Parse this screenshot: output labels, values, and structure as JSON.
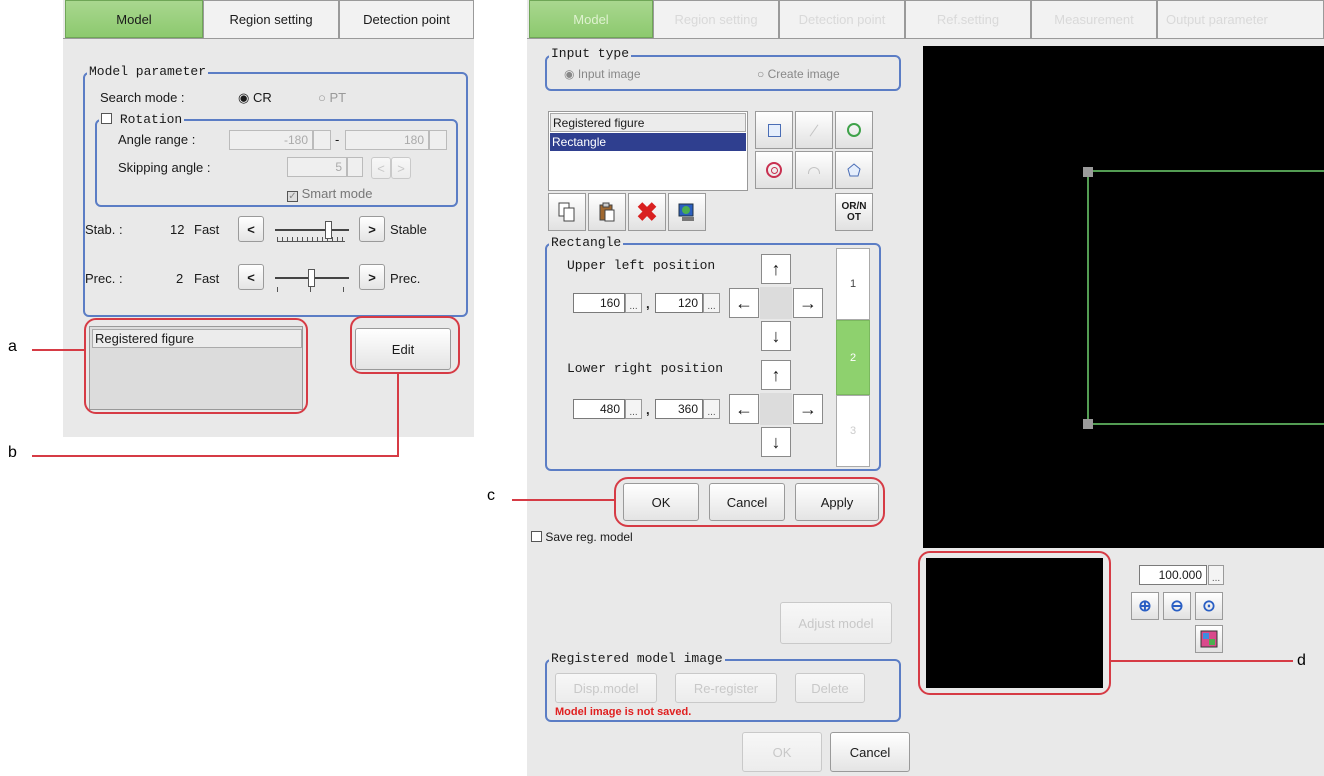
{
  "left_window": {
    "tabs": [
      "Model",
      "Region setting",
      "Detection point"
    ],
    "model_parameter": {
      "title": "Model parameter",
      "search_mode_label": "Search mode :",
      "search_mode_options": [
        "CR",
        "PT"
      ],
      "search_mode_selected": "CR",
      "rotation": {
        "title": "Rotation",
        "checked": false,
        "angle_range_label": "Angle range :",
        "angle_from": "-180",
        "angle_sep": "-",
        "angle_to": "180",
        "skipping_angle_label": "Skipping angle :",
        "skipping_angle": "5",
        "smart_mode_label": "Smart mode",
        "smart_mode_checked": true
      },
      "stab": {
        "label": "Stab. :",
        "value": "12",
        "left": "Fast",
        "right": "Stable",
        "dec": "<",
        "inc": ">",
        "level": 0.75
      },
      "prec": {
        "label": "Prec. :",
        "value": "2",
        "left": "Fast",
        "right": "Prec.",
        "dec": "<",
        "inc": ">",
        "level": 0.5
      }
    },
    "registered_figure_header": "Registered figure",
    "edit_button": "Edit"
  },
  "right_window": {
    "tabs": [
      "Model",
      "Region setting",
      "Detection point",
      "Ref.setting",
      "Measurement",
      "Output parameter"
    ],
    "input_type": {
      "title": "Input type",
      "options": [
        "Input image",
        "Create image"
      ],
      "selected": "Input image"
    },
    "registered_figure": {
      "header": "Registered figure",
      "items": [
        "Rectangle"
      ],
      "selected": "Rectangle"
    },
    "shape_buttons": [
      "rectangle-shape-icon",
      "line-shape-icon",
      "circle-shape-icon",
      "ring-shape-icon",
      "arc-shape-icon",
      "polygon-shape-icon"
    ],
    "toolbar_icons": [
      "copy-icon",
      "paste-icon",
      "delete-icon",
      "image-edit-icon"
    ],
    "or_not_button": "OR/NOT",
    "rectangle": {
      "title": "Rectangle",
      "upper_left_label": "Upper left position",
      "upper_left_x": "160",
      "upper_left_y": "120",
      "lower_right_label": "Lower right position",
      "lower_right_x": "480",
      "lower_right_y": "360",
      "comma": ",",
      "arrows": {
        "up": "↑",
        "down": "↓",
        "left": "←",
        "right": "→"
      },
      "dots": "...",
      "side_tabs": [
        "1",
        "2",
        "3"
      ],
      "side_tab_active": "2"
    },
    "ok_button": "OK",
    "cancel_button": "Cancel",
    "apply_button": "Apply",
    "save_reg_model_label": "Save reg. model",
    "adjust_model_button": "Adjust model",
    "registered_model_image": {
      "title": "Registered model image",
      "buttons": [
        "Disp.model",
        "Re-register",
        "Delete"
      ],
      "status": "Model image is not saved."
    },
    "bottom_ok": "OK",
    "bottom_cancel": "Cancel",
    "zoom_value": "100.000",
    "zoom_icons": [
      "zoom-in-icon",
      "zoom-out-icon",
      "zoom-fit-icon",
      "image-toggle-icon"
    ]
  },
  "callouts": [
    "a",
    "b",
    "c",
    "d"
  ],
  "colors": {
    "active_tab": "#8cc96e",
    "group_border": "#5b7dc5",
    "callout": "#d63b45",
    "status_text": "#e02020",
    "selection": "#2f3f8f",
    "rectangle_line": "#6fd06f"
  }
}
